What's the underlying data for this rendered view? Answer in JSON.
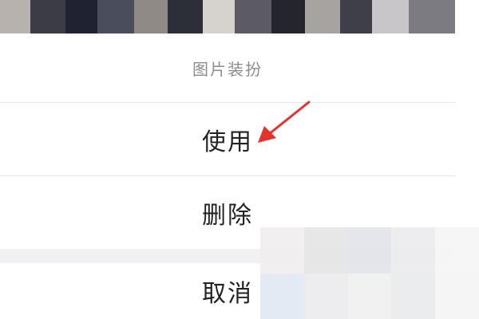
{
  "action_sheet": {
    "title": "图片装扮",
    "options": [
      {
        "label": "使用"
      },
      {
        "label": "删除"
      }
    ],
    "cancel_label": "取消"
  },
  "annotation": {
    "arrow_color": "#e5322d",
    "arrow_icon": "red-arrow-pointer"
  },
  "colors": {
    "sheet_background": "#ffffff",
    "title_text": "#8c8c8c",
    "action_text": "#222222",
    "divider": "#e6e6e6",
    "group_gap": "#f1f1f3"
  }
}
